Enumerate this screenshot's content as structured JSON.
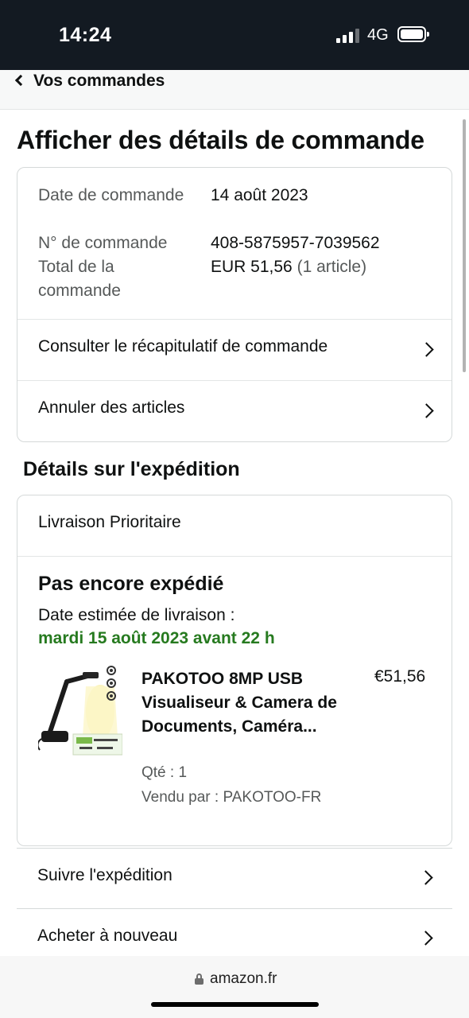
{
  "status_bar": {
    "time": "14:24",
    "network": "4G",
    "signal_bars_active": 3,
    "signal_bars_total": 4
  },
  "nav": {
    "back_label": "Vos commandes",
    "back_icon": "chevron-left-icon"
  },
  "page_title": "Afficher des détails de commande",
  "order_summary": {
    "date_label": "Date de commande",
    "date_value": "14 août 2023",
    "number_label": "N° de commande",
    "number_value": "408-5875957-7039562",
    "total_label": "Total de la commande",
    "total_value": "EUR 51,56",
    "total_count": "(1 article)",
    "links": [
      {
        "label": "Consulter le récapitulatif de commande",
        "icon": "chevron-right-icon"
      },
      {
        "label": "Annuler des articles",
        "icon": "chevron-right-icon"
      }
    ]
  },
  "shipping": {
    "heading": "Détails sur l'expédition",
    "method": "Livraison Prioritaire",
    "status": "Pas encore expédié",
    "eta_label": "Date estimée de livraison :",
    "eta_date": "mardi 15 août 2023 avant 22 h",
    "product": {
      "title": "PAKOTOO 8MP USB Visualiseur & Camera de Documents, Caméra...",
      "price": "€51,56",
      "qty": "Qté : 1",
      "seller": "Vendu par : PAKOTOO-FR",
      "image": "document-camera-product-image"
    }
  },
  "actions": [
    {
      "label": "Suivre l'expédition",
      "icon": "chevron-right-icon"
    },
    {
      "label": "Acheter à nouveau",
      "icon": "chevron-right-icon"
    }
  ],
  "browser": {
    "domain": "amazon.fr",
    "icon": "lock-icon"
  },
  "colors": {
    "status_bar": "#131a22",
    "eta_green": "#267a1f",
    "text": "#0f1111",
    "muted": "#565959",
    "border": "#d5d9d9"
  }
}
